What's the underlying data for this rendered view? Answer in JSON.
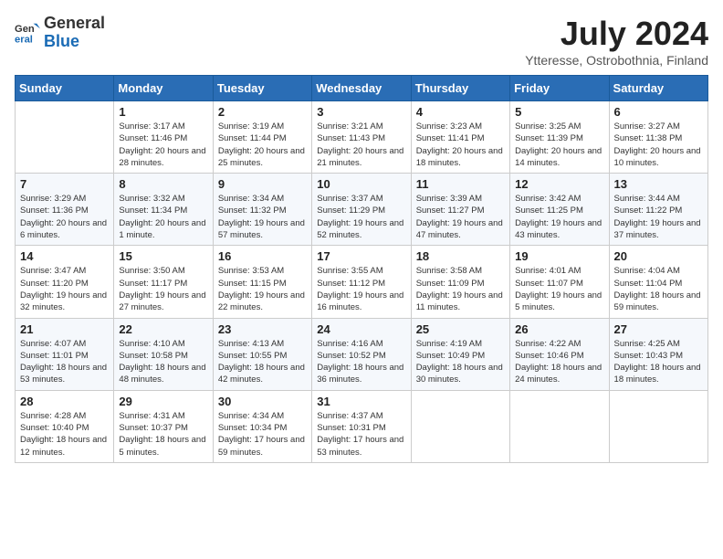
{
  "logo": {
    "text_general": "General",
    "text_blue": "Blue"
  },
  "header": {
    "title": "July 2024",
    "location": "Ytteresse, Ostrobothnia, Finland"
  },
  "weekdays": [
    "Sunday",
    "Monday",
    "Tuesday",
    "Wednesday",
    "Thursday",
    "Friday",
    "Saturday"
  ],
  "weeks": [
    [
      {
        "day": "",
        "sunrise": "",
        "sunset": "",
        "daylight": ""
      },
      {
        "day": "1",
        "sunrise": "Sunrise: 3:17 AM",
        "sunset": "Sunset: 11:46 PM",
        "daylight": "Daylight: 20 hours and 28 minutes."
      },
      {
        "day": "2",
        "sunrise": "Sunrise: 3:19 AM",
        "sunset": "Sunset: 11:44 PM",
        "daylight": "Daylight: 20 hours and 25 minutes."
      },
      {
        "day": "3",
        "sunrise": "Sunrise: 3:21 AM",
        "sunset": "Sunset: 11:43 PM",
        "daylight": "Daylight: 20 hours and 21 minutes."
      },
      {
        "day": "4",
        "sunrise": "Sunrise: 3:23 AM",
        "sunset": "Sunset: 11:41 PM",
        "daylight": "Daylight: 20 hours and 18 minutes."
      },
      {
        "day": "5",
        "sunrise": "Sunrise: 3:25 AM",
        "sunset": "Sunset: 11:39 PM",
        "daylight": "Daylight: 20 hours and 14 minutes."
      },
      {
        "day": "6",
        "sunrise": "Sunrise: 3:27 AM",
        "sunset": "Sunset: 11:38 PM",
        "daylight": "Daylight: 20 hours and 10 minutes."
      }
    ],
    [
      {
        "day": "7",
        "sunrise": "Sunrise: 3:29 AM",
        "sunset": "Sunset: 11:36 PM",
        "daylight": "Daylight: 20 hours and 6 minutes."
      },
      {
        "day": "8",
        "sunrise": "Sunrise: 3:32 AM",
        "sunset": "Sunset: 11:34 PM",
        "daylight": "Daylight: 20 hours and 1 minute."
      },
      {
        "day": "9",
        "sunrise": "Sunrise: 3:34 AM",
        "sunset": "Sunset: 11:32 PM",
        "daylight": "Daylight: 19 hours and 57 minutes."
      },
      {
        "day": "10",
        "sunrise": "Sunrise: 3:37 AM",
        "sunset": "Sunset: 11:29 PM",
        "daylight": "Daylight: 19 hours and 52 minutes."
      },
      {
        "day": "11",
        "sunrise": "Sunrise: 3:39 AM",
        "sunset": "Sunset: 11:27 PM",
        "daylight": "Daylight: 19 hours and 47 minutes."
      },
      {
        "day": "12",
        "sunrise": "Sunrise: 3:42 AM",
        "sunset": "Sunset: 11:25 PM",
        "daylight": "Daylight: 19 hours and 43 minutes."
      },
      {
        "day": "13",
        "sunrise": "Sunrise: 3:44 AM",
        "sunset": "Sunset: 11:22 PM",
        "daylight": "Daylight: 19 hours and 37 minutes."
      }
    ],
    [
      {
        "day": "14",
        "sunrise": "Sunrise: 3:47 AM",
        "sunset": "Sunset: 11:20 PM",
        "daylight": "Daylight: 19 hours and 32 minutes."
      },
      {
        "day": "15",
        "sunrise": "Sunrise: 3:50 AM",
        "sunset": "Sunset: 11:17 PM",
        "daylight": "Daylight: 19 hours and 27 minutes."
      },
      {
        "day": "16",
        "sunrise": "Sunrise: 3:53 AM",
        "sunset": "Sunset: 11:15 PM",
        "daylight": "Daylight: 19 hours and 22 minutes."
      },
      {
        "day": "17",
        "sunrise": "Sunrise: 3:55 AM",
        "sunset": "Sunset: 11:12 PM",
        "daylight": "Daylight: 19 hours and 16 minutes."
      },
      {
        "day": "18",
        "sunrise": "Sunrise: 3:58 AM",
        "sunset": "Sunset: 11:09 PM",
        "daylight": "Daylight: 19 hours and 11 minutes."
      },
      {
        "day": "19",
        "sunrise": "Sunrise: 4:01 AM",
        "sunset": "Sunset: 11:07 PM",
        "daylight": "Daylight: 19 hours and 5 minutes."
      },
      {
        "day": "20",
        "sunrise": "Sunrise: 4:04 AM",
        "sunset": "Sunset: 11:04 PM",
        "daylight": "Daylight: 18 hours and 59 minutes."
      }
    ],
    [
      {
        "day": "21",
        "sunrise": "Sunrise: 4:07 AM",
        "sunset": "Sunset: 11:01 PM",
        "daylight": "Daylight: 18 hours and 53 minutes."
      },
      {
        "day": "22",
        "sunrise": "Sunrise: 4:10 AM",
        "sunset": "Sunset: 10:58 PM",
        "daylight": "Daylight: 18 hours and 48 minutes."
      },
      {
        "day": "23",
        "sunrise": "Sunrise: 4:13 AM",
        "sunset": "Sunset: 10:55 PM",
        "daylight": "Daylight: 18 hours and 42 minutes."
      },
      {
        "day": "24",
        "sunrise": "Sunrise: 4:16 AM",
        "sunset": "Sunset: 10:52 PM",
        "daylight": "Daylight: 18 hours and 36 minutes."
      },
      {
        "day": "25",
        "sunrise": "Sunrise: 4:19 AM",
        "sunset": "Sunset: 10:49 PM",
        "daylight": "Daylight: 18 hours and 30 minutes."
      },
      {
        "day": "26",
        "sunrise": "Sunrise: 4:22 AM",
        "sunset": "Sunset: 10:46 PM",
        "daylight": "Daylight: 18 hours and 24 minutes."
      },
      {
        "day": "27",
        "sunrise": "Sunrise: 4:25 AM",
        "sunset": "Sunset: 10:43 PM",
        "daylight": "Daylight: 18 hours and 18 minutes."
      }
    ],
    [
      {
        "day": "28",
        "sunrise": "Sunrise: 4:28 AM",
        "sunset": "Sunset: 10:40 PM",
        "daylight": "Daylight: 18 hours and 12 minutes."
      },
      {
        "day": "29",
        "sunrise": "Sunrise: 4:31 AM",
        "sunset": "Sunset: 10:37 PM",
        "daylight": "Daylight: 18 hours and 5 minutes."
      },
      {
        "day": "30",
        "sunrise": "Sunrise: 4:34 AM",
        "sunset": "Sunset: 10:34 PM",
        "daylight": "Daylight: 17 hours and 59 minutes."
      },
      {
        "day": "31",
        "sunrise": "Sunrise: 4:37 AM",
        "sunset": "Sunset: 10:31 PM",
        "daylight": "Daylight: 17 hours and 53 minutes."
      },
      {
        "day": "",
        "sunrise": "",
        "sunset": "",
        "daylight": ""
      },
      {
        "day": "",
        "sunrise": "",
        "sunset": "",
        "daylight": ""
      },
      {
        "day": "",
        "sunrise": "",
        "sunset": "",
        "daylight": ""
      }
    ]
  ]
}
